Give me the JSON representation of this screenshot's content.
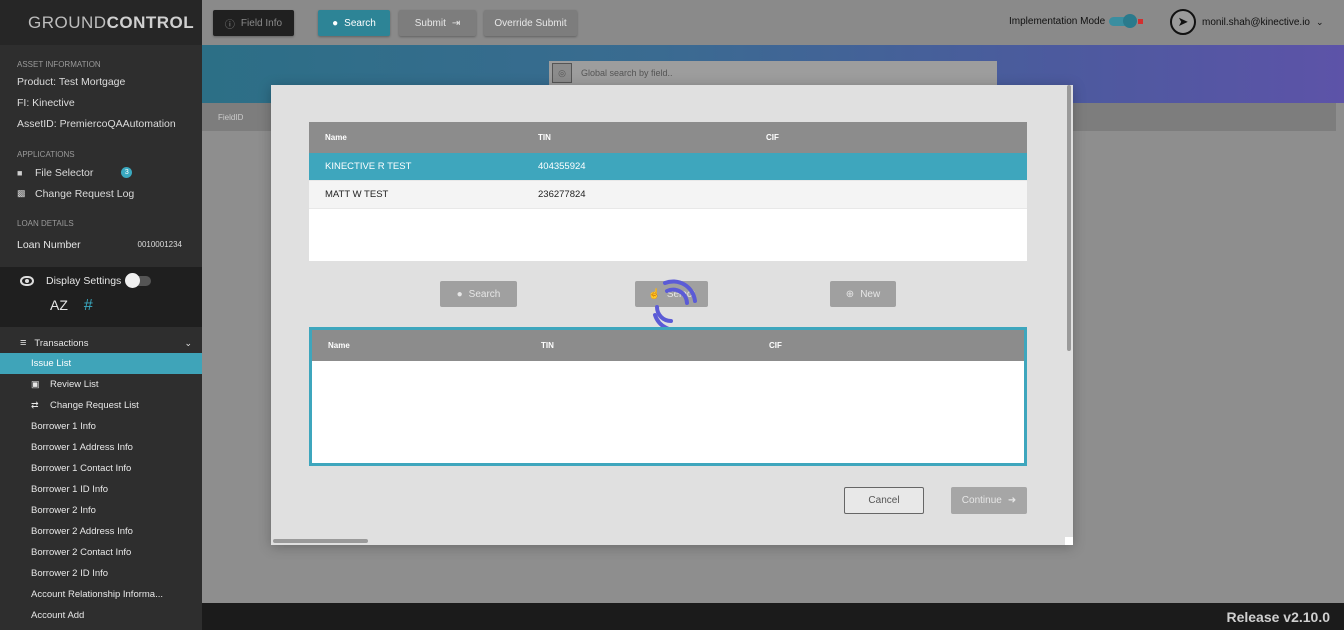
{
  "brand": {
    "name_light": "GROUND",
    "name_bold": "CONTROL"
  },
  "asset_info": {
    "title": "ASSET INFORMATION",
    "product": "Product:  Test Mortgage",
    "fi": "FI:  Kinective",
    "asset_id": "AssetID:  PremiercoQAAutomation"
  },
  "applications": {
    "title": "APPLICATIONS",
    "file_selector": "File Selector",
    "file_selector_badge": "3",
    "change_request_log": "Change Request Log"
  },
  "loan_details": {
    "title": "LOAN DETAILS",
    "loan_number_label": "Loan Number",
    "loan_number_value": "0010001234"
  },
  "display_settings": {
    "label": "Display Settings",
    "sort_icon_text": "AZ",
    "hash_text": "#"
  },
  "transactions": {
    "label": "Transactions",
    "items": [
      "Issue List",
      "Review List",
      "Change Request List",
      "Borrower 1 Info",
      "Borrower 1 Address Info",
      "Borrower 1 Contact Info",
      "Borrower 1 ID Info",
      "Borrower 2 Info",
      "Borrower 2 Address Info",
      "Borrower 2 Contact Info",
      "Borrower 2 ID Info",
      "Account Relationship Informa...",
      "Account Add"
    ]
  },
  "toolbar": {
    "field_info": "Field Info",
    "search": "Search",
    "submit": "Submit",
    "override_submit": "Override Submit",
    "implementation_mode": "Implementation Mode",
    "user_email": "monil.shah@kinective.io"
  },
  "global_search": {
    "placeholder": "Global search by field.."
  },
  "field_id_header": "FieldID",
  "modal": {
    "columns": [
      "Name",
      "TIN",
      "CIF"
    ],
    "results": [
      {
        "name": "KINECTIVE R TEST",
        "tin": "404355924",
        "cif": ""
      },
      {
        "name": "MATT W TEST",
        "tin": "236277824",
        "cif": ""
      }
    ],
    "search_button": "Search",
    "select_button": "Select",
    "new_button": "New",
    "cancel_button": "Cancel",
    "continue_button": "Continue"
  },
  "footer": {
    "release": "Release v2.10.0"
  },
  "colors": {
    "accent": "#3ea6bd",
    "sidebar": "#2e2e2e",
    "spinner": "#5b5bd6"
  }
}
